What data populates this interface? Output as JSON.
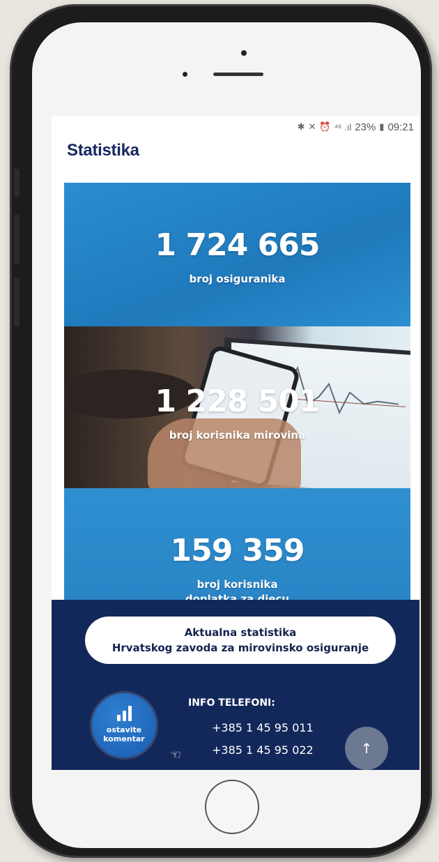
{
  "status_bar": {
    "icons": [
      "bluetooth-icon",
      "mute-icon",
      "alarm-icon",
      "signal-icon"
    ],
    "signal": "⁴⁶ .ıl",
    "battery": "23%",
    "time": "09:21"
  },
  "page": {
    "title": "Statistika"
  },
  "stats": [
    {
      "number": "1 724 665",
      "label": "broj osiguranika"
    },
    {
      "number": "1 228 501",
      "label": "broj korisnika mirovina"
    },
    {
      "number": "159 359",
      "label_line1": "broj korisnika",
      "label_line2": "doplatka za djecu"
    }
  ],
  "cta": {
    "line1": "Aktualna statistika",
    "line2": "Hrvatskog zavoda za mirovinsko osiguranje"
  },
  "feedback": {
    "line1": "ostavite",
    "line2": "komentar",
    "icon": "bar-chart-icon"
  },
  "info": {
    "title": "INFO TELEFONI:",
    "phones": [
      "+385 1 45 95 011",
      "+385 1 45 95 022"
    ]
  },
  "scroll_top": {
    "icon": "arrow-up-icon",
    "glyph": "↑"
  },
  "colors": {
    "navy": "#13285a",
    "accent_blue": "#2a8ecf",
    "title": "#17275f"
  }
}
